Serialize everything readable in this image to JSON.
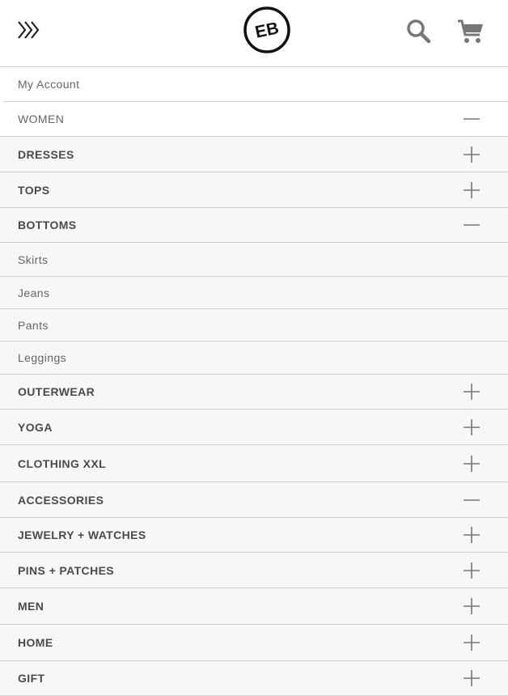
{
  "header": {
    "logo_text": "EB",
    "menu_icon": "triple-chevron-icon",
    "search_icon": "search-icon",
    "cart_icon": "cart-icon"
  },
  "menu": {
    "items": [
      {
        "label": "My Account",
        "state": "none"
      },
      {
        "label": "WOMEN",
        "state": "expanded"
      },
      {
        "label": "DRESSES",
        "state": "collapsed"
      },
      {
        "label": "TOPS",
        "state": "collapsed"
      },
      {
        "label": "BOTTOMS",
        "state": "expanded"
      },
      {
        "label": "Skirts",
        "state": "none"
      },
      {
        "label": "Jeans",
        "state": "none"
      },
      {
        "label": "Pants",
        "state": "none"
      },
      {
        "label": "Leggings",
        "state": "none"
      },
      {
        "label": "OUTERWEAR",
        "state": "collapsed"
      },
      {
        "label": "YOGA",
        "state": "collapsed"
      },
      {
        "label": "CLOTHING XXL",
        "state": "collapsed"
      },
      {
        "label": "ACCESSORIES",
        "state": "expanded"
      },
      {
        "label": "JEWELRY + WATCHES",
        "state": "collapsed"
      },
      {
        "label": "PINS + PATCHES",
        "state": "collapsed"
      },
      {
        "label": "MEN",
        "state": "collapsed"
      },
      {
        "label": "HOME",
        "state": "collapsed"
      },
      {
        "label": "GIFT",
        "state": "collapsed"
      }
    ]
  },
  "colors": {
    "text": "#555555",
    "divider": "#cfcfcf",
    "row_bg": "#f7f7f7",
    "icon": "#777777"
  }
}
